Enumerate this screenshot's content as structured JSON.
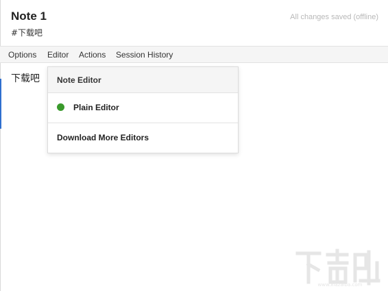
{
  "note": {
    "title": "Note 1",
    "tag": "#下载吧",
    "save_status": "All changes saved (offline)",
    "body_text": "下载吧"
  },
  "menu": {
    "items": [
      {
        "label": "Options"
      },
      {
        "label": "Editor"
      },
      {
        "label": "Actions"
      },
      {
        "label": "Session History"
      }
    ]
  },
  "editor_menu": {
    "header": "Note Editor",
    "items": [
      {
        "label": "Plain Editor",
        "status_color": "#3a9a2c",
        "selected": true
      },
      {
        "label": "Download More Editors"
      }
    ]
  },
  "colors": {
    "accent": "#2f6fce",
    "active_dot": "#3a9a2c"
  },
  "watermark": {
    "text": "下载吧",
    "url": "www.xiazaiba.com"
  }
}
